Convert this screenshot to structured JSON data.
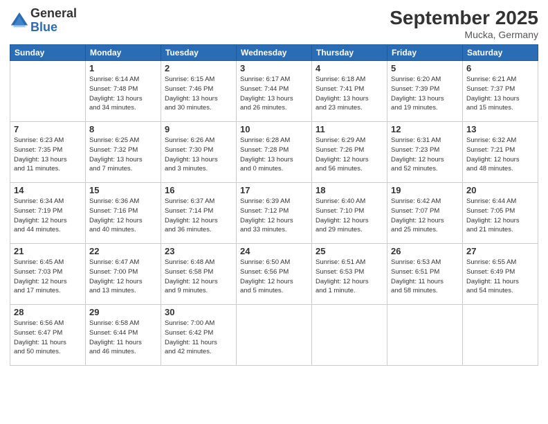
{
  "logo": {
    "general": "General",
    "blue": "Blue"
  },
  "header": {
    "month": "September 2025",
    "location": "Mucka, Germany"
  },
  "weekdays": [
    "Sunday",
    "Monday",
    "Tuesday",
    "Wednesday",
    "Thursday",
    "Friday",
    "Saturday"
  ],
  "weeks": [
    [
      {
        "day": "",
        "info": ""
      },
      {
        "day": "1",
        "info": "Sunrise: 6:14 AM\nSunset: 7:48 PM\nDaylight: 13 hours\nand 34 minutes."
      },
      {
        "day": "2",
        "info": "Sunrise: 6:15 AM\nSunset: 7:46 PM\nDaylight: 13 hours\nand 30 minutes."
      },
      {
        "day": "3",
        "info": "Sunrise: 6:17 AM\nSunset: 7:44 PM\nDaylight: 13 hours\nand 26 minutes."
      },
      {
        "day": "4",
        "info": "Sunrise: 6:18 AM\nSunset: 7:41 PM\nDaylight: 13 hours\nand 23 minutes."
      },
      {
        "day": "5",
        "info": "Sunrise: 6:20 AM\nSunset: 7:39 PM\nDaylight: 13 hours\nand 19 minutes."
      },
      {
        "day": "6",
        "info": "Sunrise: 6:21 AM\nSunset: 7:37 PM\nDaylight: 13 hours\nand 15 minutes."
      }
    ],
    [
      {
        "day": "7",
        "info": "Sunrise: 6:23 AM\nSunset: 7:35 PM\nDaylight: 13 hours\nand 11 minutes."
      },
      {
        "day": "8",
        "info": "Sunrise: 6:25 AM\nSunset: 7:32 PM\nDaylight: 13 hours\nand 7 minutes."
      },
      {
        "day": "9",
        "info": "Sunrise: 6:26 AM\nSunset: 7:30 PM\nDaylight: 13 hours\nand 3 minutes."
      },
      {
        "day": "10",
        "info": "Sunrise: 6:28 AM\nSunset: 7:28 PM\nDaylight: 13 hours\nand 0 minutes."
      },
      {
        "day": "11",
        "info": "Sunrise: 6:29 AM\nSunset: 7:26 PM\nDaylight: 12 hours\nand 56 minutes."
      },
      {
        "day": "12",
        "info": "Sunrise: 6:31 AM\nSunset: 7:23 PM\nDaylight: 12 hours\nand 52 minutes."
      },
      {
        "day": "13",
        "info": "Sunrise: 6:32 AM\nSunset: 7:21 PM\nDaylight: 12 hours\nand 48 minutes."
      }
    ],
    [
      {
        "day": "14",
        "info": "Sunrise: 6:34 AM\nSunset: 7:19 PM\nDaylight: 12 hours\nand 44 minutes."
      },
      {
        "day": "15",
        "info": "Sunrise: 6:36 AM\nSunset: 7:16 PM\nDaylight: 12 hours\nand 40 minutes."
      },
      {
        "day": "16",
        "info": "Sunrise: 6:37 AM\nSunset: 7:14 PM\nDaylight: 12 hours\nand 36 minutes."
      },
      {
        "day": "17",
        "info": "Sunrise: 6:39 AM\nSunset: 7:12 PM\nDaylight: 12 hours\nand 33 minutes."
      },
      {
        "day": "18",
        "info": "Sunrise: 6:40 AM\nSunset: 7:10 PM\nDaylight: 12 hours\nand 29 minutes."
      },
      {
        "day": "19",
        "info": "Sunrise: 6:42 AM\nSunset: 7:07 PM\nDaylight: 12 hours\nand 25 minutes."
      },
      {
        "day": "20",
        "info": "Sunrise: 6:44 AM\nSunset: 7:05 PM\nDaylight: 12 hours\nand 21 minutes."
      }
    ],
    [
      {
        "day": "21",
        "info": "Sunrise: 6:45 AM\nSunset: 7:03 PM\nDaylight: 12 hours\nand 17 minutes."
      },
      {
        "day": "22",
        "info": "Sunrise: 6:47 AM\nSunset: 7:00 PM\nDaylight: 12 hours\nand 13 minutes."
      },
      {
        "day": "23",
        "info": "Sunrise: 6:48 AM\nSunset: 6:58 PM\nDaylight: 12 hours\nand 9 minutes."
      },
      {
        "day": "24",
        "info": "Sunrise: 6:50 AM\nSunset: 6:56 PM\nDaylight: 12 hours\nand 5 minutes."
      },
      {
        "day": "25",
        "info": "Sunrise: 6:51 AM\nSunset: 6:53 PM\nDaylight: 12 hours\nand 1 minute."
      },
      {
        "day": "26",
        "info": "Sunrise: 6:53 AM\nSunset: 6:51 PM\nDaylight: 11 hours\nand 58 minutes."
      },
      {
        "day": "27",
        "info": "Sunrise: 6:55 AM\nSunset: 6:49 PM\nDaylight: 11 hours\nand 54 minutes."
      }
    ],
    [
      {
        "day": "28",
        "info": "Sunrise: 6:56 AM\nSunset: 6:47 PM\nDaylight: 11 hours\nand 50 minutes."
      },
      {
        "day": "29",
        "info": "Sunrise: 6:58 AM\nSunset: 6:44 PM\nDaylight: 11 hours\nand 46 minutes."
      },
      {
        "day": "30",
        "info": "Sunrise: 7:00 AM\nSunset: 6:42 PM\nDaylight: 11 hours\nand 42 minutes."
      },
      {
        "day": "",
        "info": ""
      },
      {
        "day": "",
        "info": ""
      },
      {
        "day": "",
        "info": ""
      },
      {
        "day": "",
        "info": ""
      }
    ]
  ]
}
